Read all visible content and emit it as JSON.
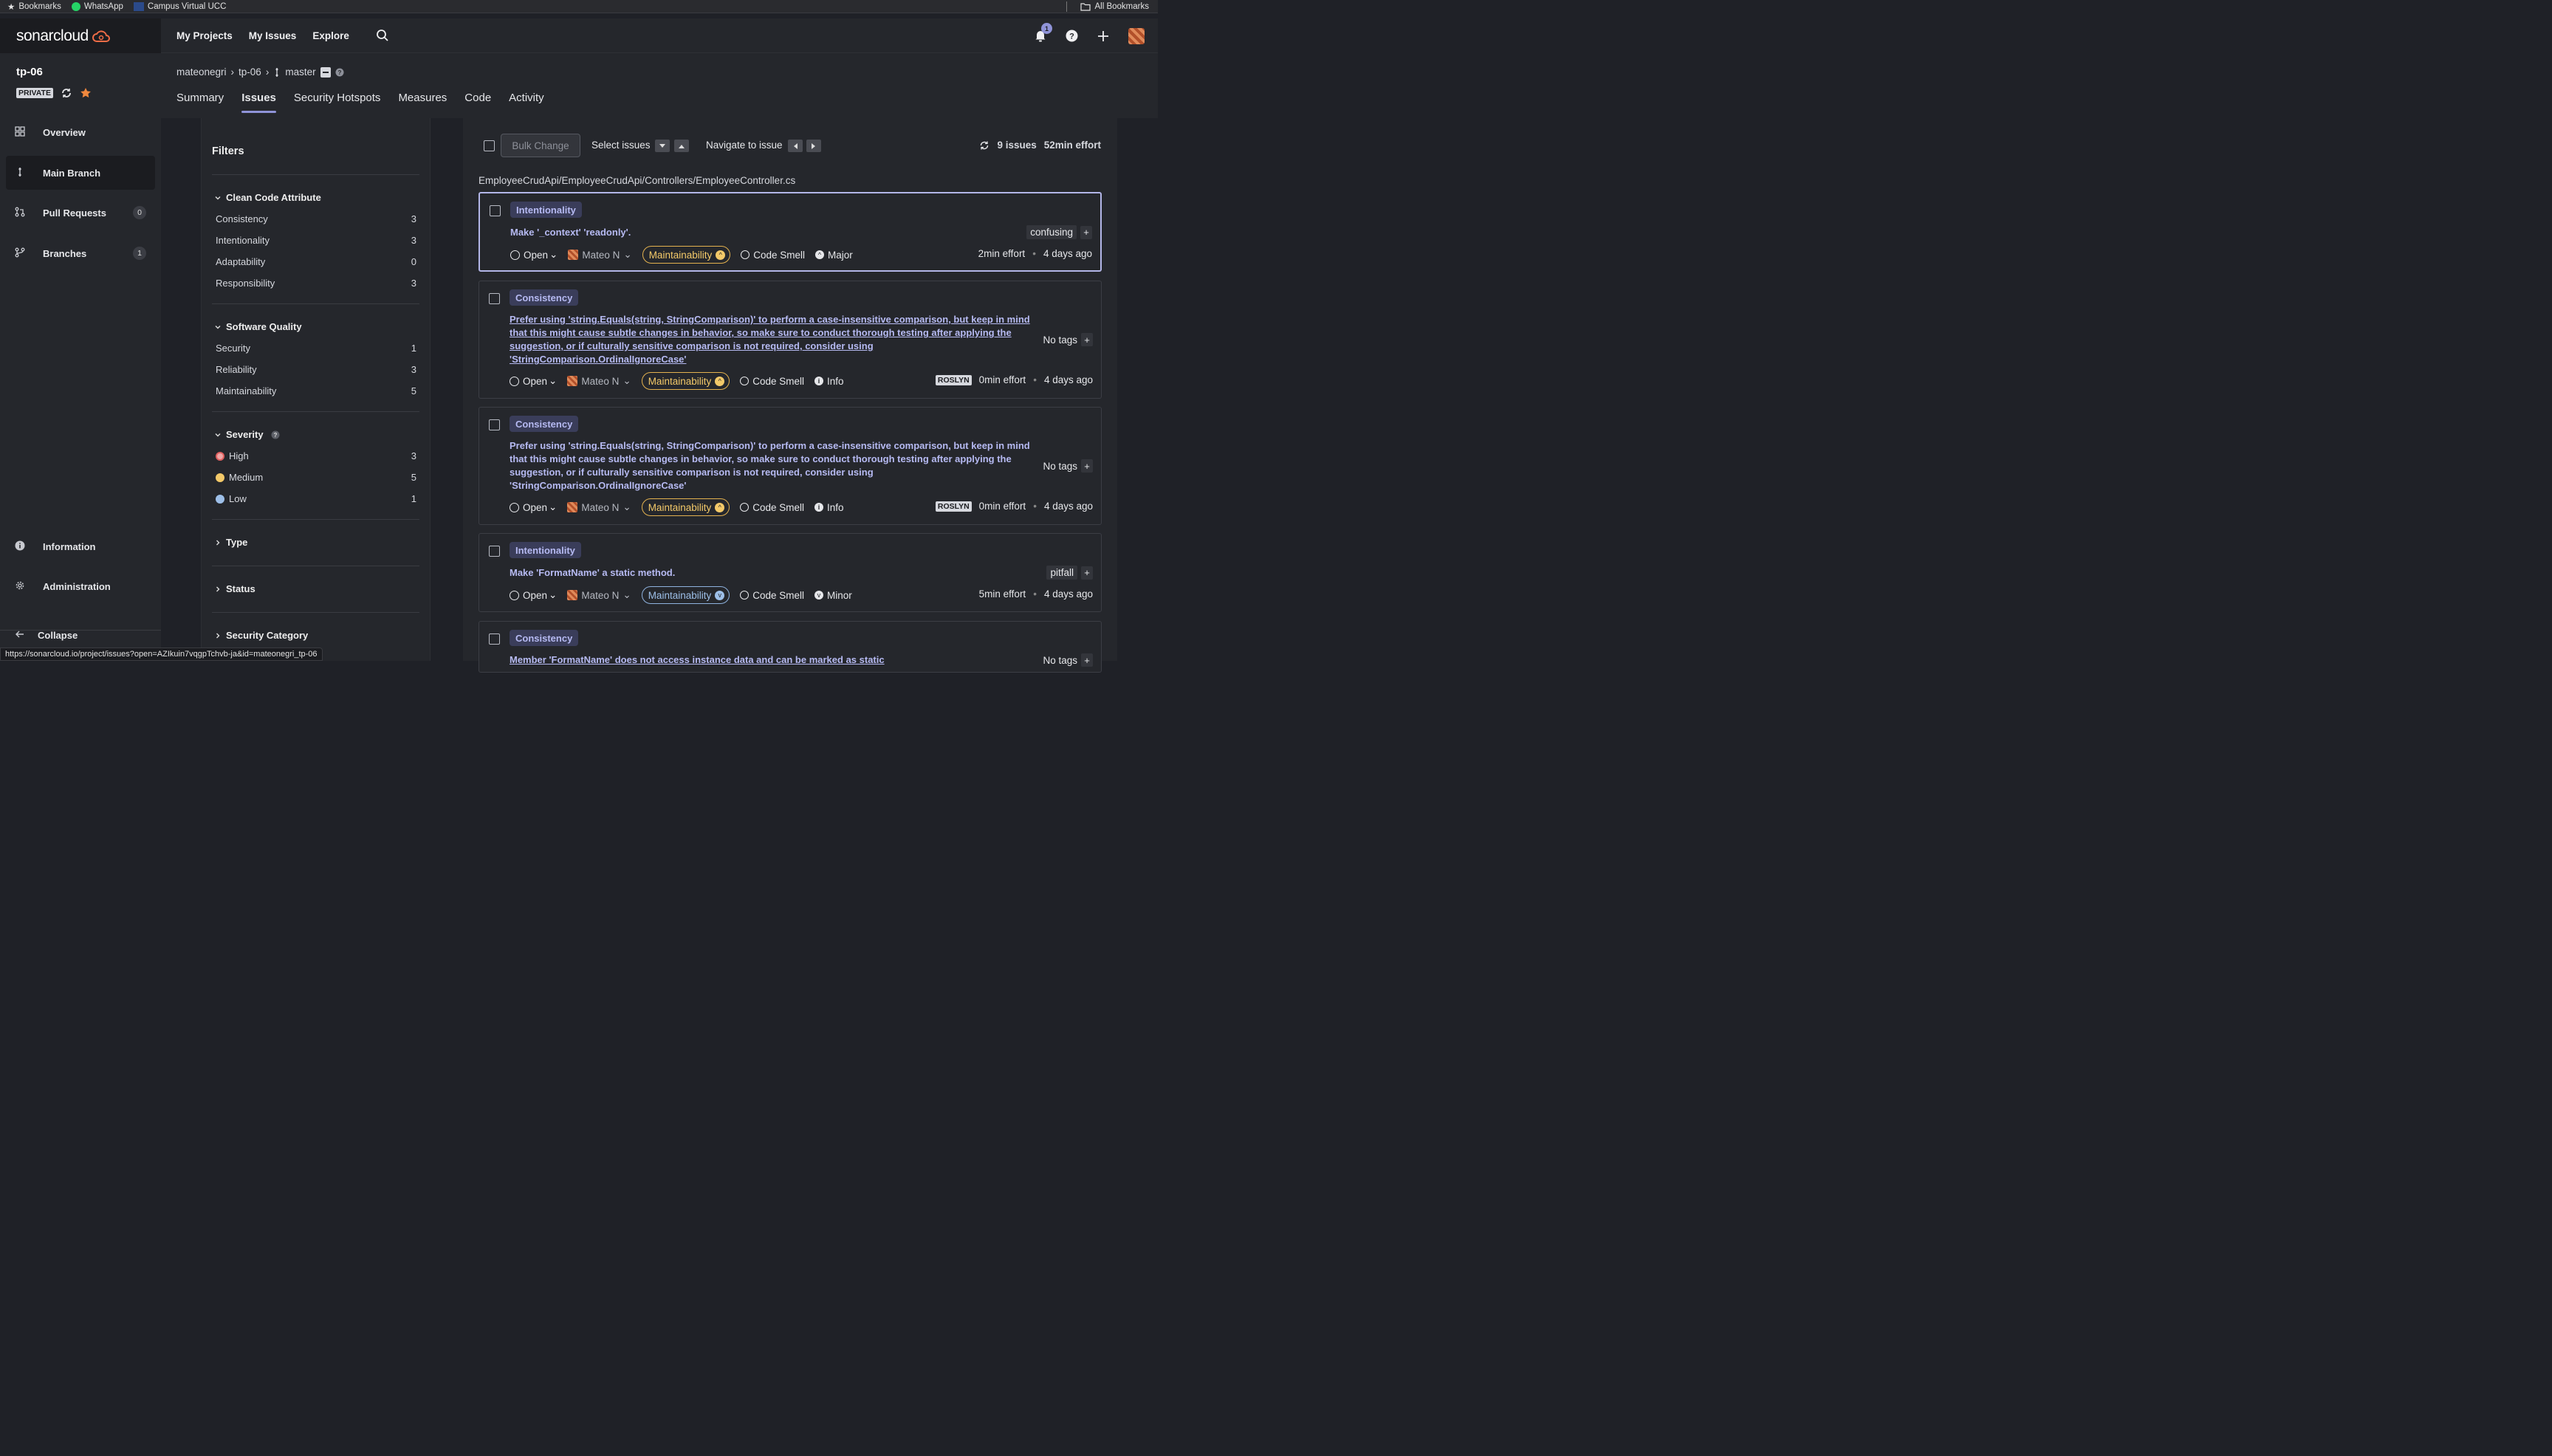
{
  "browser": {
    "bookmarks": [
      {
        "label": "Bookmarks",
        "icon": "star-icon"
      },
      {
        "label": "WhatsApp",
        "icon": "whatsapp-icon"
      },
      {
        "label": "Campus Virtual UCC",
        "icon": "campus-icon"
      }
    ],
    "all_bookmarks": "All Bookmarks",
    "status_url": "https://sonarcloud.io/project/issues?open=AZIkuin7vqgpTchvb-ja&id=mateonegri_tp-06"
  },
  "brand": {
    "logo_text": "sonarcloud"
  },
  "colors": {
    "accent": "#8f93d8",
    "attribute": "#b6baf2",
    "maintainability": "#f3c969",
    "low_quality": "#9dbfe8"
  },
  "topnav": {
    "links": [
      "My Projects",
      "My Issues",
      "Explore"
    ],
    "notification_count": "1"
  },
  "project": {
    "name": "tp-06",
    "visibility": "PRIVATE"
  },
  "sidebar": {
    "items": [
      {
        "label": "Overview",
        "icon": "overview-icon"
      },
      {
        "label": "Main Branch",
        "icon": "branch-icon",
        "active": true
      },
      {
        "label": "Pull Requests",
        "icon": "pull-request-icon",
        "count": "0"
      },
      {
        "label": "Branches",
        "icon": "branches-icon",
        "count": "1"
      }
    ],
    "bottom": [
      {
        "label": "Information",
        "icon": "info-icon"
      },
      {
        "label": "Administration",
        "icon": "gear-icon"
      }
    ],
    "collapse": "Collapse"
  },
  "breadcrumb": {
    "org": "mateonegri",
    "project": "tp-06",
    "branch": "master"
  },
  "tabs": [
    "Summary",
    "Issues",
    "Security Hotspots",
    "Measures",
    "Code",
    "Activity"
  ],
  "filters": {
    "title": "Filters",
    "clean_code": {
      "title": "Clean Code Attribute",
      "rows": [
        {
          "label": "Consistency",
          "count": "3"
        },
        {
          "label": "Intentionality",
          "count": "3"
        },
        {
          "label": "Adaptability",
          "count": "0"
        },
        {
          "label": "Responsibility",
          "count": "3"
        }
      ]
    },
    "software_quality": {
      "title": "Software Quality",
      "rows": [
        {
          "label": "Security",
          "count": "1"
        },
        {
          "label": "Reliability",
          "count": "3"
        },
        {
          "label": "Maintainability",
          "count": "5"
        }
      ]
    },
    "severity": {
      "title": "Severity",
      "rows": [
        {
          "label": "High",
          "count": "3"
        },
        {
          "label": "Medium",
          "count": "5"
        },
        {
          "label": "Low",
          "count": "1"
        }
      ]
    },
    "collapsed": [
      "Type",
      "Status",
      "Security Category"
    ]
  },
  "toolbar": {
    "bulk_change": "Bulk Change",
    "select_issues": "Select issues",
    "navigate": "Navigate to issue",
    "issues_count": "9 issues",
    "effort": "52min effort"
  },
  "file_path": "EmployeeCrudApi/EmployeeCrudApi/Controllers/EmployeeController.cs",
  "issues": [
    {
      "attribute": "Intentionality",
      "message": "Make '_context' 'readonly'.",
      "status": "Open",
      "assignee": "Mateo N",
      "quality": "Maintainability",
      "type": "Code Smell",
      "severity": "Major",
      "tag": "confusing",
      "effort": "2min effort",
      "age": "4 days ago"
    },
    {
      "attribute": "Consistency",
      "message": "Prefer using 'string.Equals(string, StringComparison)' to perform a case-insensitive comparison, but keep in mind that this might cause subtle changes in behavior, so make sure to conduct thorough testing after applying the suggestion, or if culturally sensitive comparison is not required, consider using 'StringComparison.OrdinalIgnoreCase'",
      "status": "Open",
      "assignee": "Mateo N",
      "quality": "Maintainability",
      "type": "Code Smell",
      "severity": "Info",
      "tag": "No tags",
      "engine": "ROSLYN",
      "effort": "0min effort",
      "age": "4 days ago"
    },
    {
      "attribute": "Consistency",
      "message": "Prefer using 'string.Equals(string, StringComparison)' to perform a case-insensitive comparison, but keep in mind that this might cause subtle changes in behavior, so make sure to conduct thorough testing after applying the suggestion, or if culturally sensitive comparison is not required, consider using 'StringComparison.OrdinalIgnoreCase'",
      "status": "Open",
      "assignee": "Mateo N",
      "quality": "Maintainability",
      "type": "Code Smell",
      "severity": "Info",
      "tag": "No tags",
      "engine": "ROSLYN",
      "effort": "0min effort",
      "age": "4 days ago"
    },
    {
      "attribute": "Intentionality",
      "message": "Make 'FormatName' a static method.",
      "status": "Open",
      "assignee": "Mateo N",
      "quality": "Maintainability",
      "type": "Code Smell",
      "severity": "Minor",
      "tag": "pitfall",
      "effort": "5min effort",
      "age": "4 days ago"
    },
    {
      "attribute": "Consistency",
      "message": "Member 'FormatName' does not access instance data and can be marked as static",
      "tag": "No tags"
    }
  ]
}
